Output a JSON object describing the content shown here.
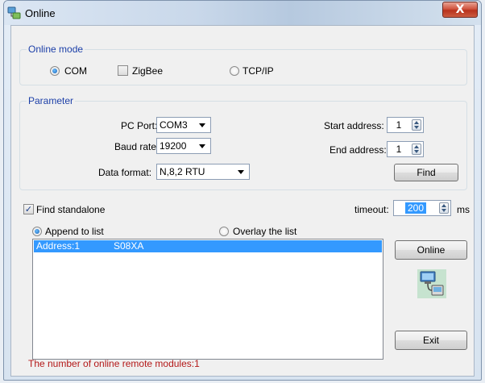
{
  "window": {
    "title": "Online",
    "close_label": "X"
  },
  "online_mode": {
    "legend": "Online mode",
    "options": [
      {
        "label": "COM",
        "type": "radio",
        "selected": true
      },
      {
        "label": "ZigBee",
        "type": "checkbox",
        "checked": false
      },
      {
        "label": "TCP/IP",
        "type": "radio",
        "selected": false
      }
    ]
  },
  "parameter": {
    "legend": "Parameter",
    "pc_port_label": "PC Port:",
    "pc_port_value": "COM3",
    "baud_rate_label": "Baud rate:",
    "baud_rate_value": "19200",
    "data_format_label": "Data format:",
    "data_format_value": "N,8,2 RTU",
    "start_address_label": "Start address:",
    "start_address_value": "1",
    "end_address_label": "End address:",
    "end_address_value": "1",
    "find_button": "Find"
  },
  "standalone": {
    "label": "Find standalone",
    "checked": true
  },
  "timeout": {
    "label": "timeout:",
    "value": "200",
    "unit": "ms"
  },
  "list_mode": {
    "append_label": "Append to list",
    "append_selected": true,
    "overlay_label": "Overlay the list",
    "overlay_selected": false
  },
  "list": {
    "items": [
      {
        "address": "Address:1",
        "model": "S08XA",
        "selected": true
      }
    ]
  },
  "buttons": {
    "online": "Online",
    "exit": "Exit"
  },
  "status": {
    "text": "The number of online remote modules:1",
    "color": "#b41818"
  },
  "colors": {
    "accent": "#1c3fa8",
    "selection": "#3399ff"
  }
}
